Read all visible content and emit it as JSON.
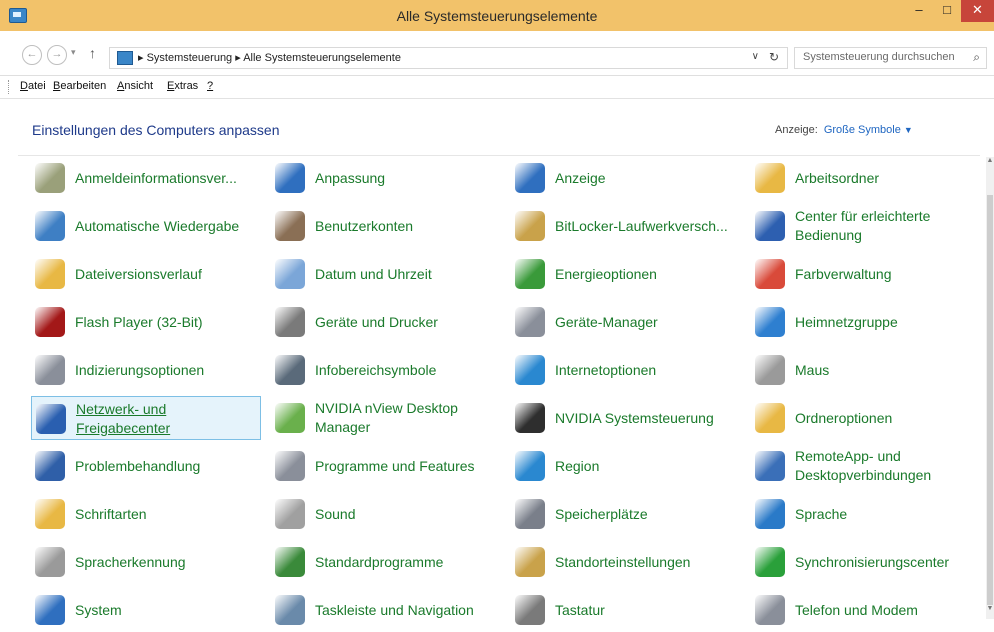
{
  "window": {
    "title": "Alle Systemsteuerungselemente",
    "controls": {
      "minimize": "–",
      "maximize": "□",
      "close": "✕"
    }
  },
  "address": {
    "back": "←",
    "forward": "→",
    "history": "▾",
    "up": "↑",
    "path": "▸ Systemsteuerung ▸ Alle Systemsteuerungselemente",
    "dropdown": "∨",
    "refresh": "↻",
    "search_placeholder": "Systemsteuerung durchsuchen",
    "search_icon": "⌕"
  },
  "menu": [
    {
      "accel": "D",
      "rest": "atei"
    },
    {
      "accel": "B",
      "rest": "earbeiten"
    },
    {
      "accel": "A",
      "rest": "nsicht"
    },
    {
      "accel": "E",
      "rest": "xtras",
      "prefix": ""
    },
    {
      "accel": "?",
      "rest": ""
    }
  ],
  "header": {
    "title": "Einstellungen des Computers anpassen",
    "view_label": "Anzeige:",
    "view_value": "Große Symbole",
    "view_caret": "▼"
  },
  "items": [
    {
      "label": "Anmeldeinformationsver...",
      "icon": "credential-manager-icon",
      "color": "#9aa07a"
    },
    {
      "label": "Anpassung",
      "icon": "personalization-icon",
      "color": "#2f6fbf"
    },
    {
      "label": "Anzeige",
      "icon": "display-icon",
      "color": "#2f6fbf"
    },
    {
      "label": "Arbeitsordner",
      "icon": "work-folders-icon",
      "color": "#e8b844"
    },
    {
      "label": "Automatische Wiedergabe",
      "icon": "autoplay-icon",
      "color": "#3e7fc4"
    },
    {
      "label": "Benutzerkonten",
      "icon": "user-accounts-icon",
      "color": "#8a6f55"
    },
    {
      "label": "BitLocker-Laufwerkversch...",
      "icon": "bitlocker-icon",
      "color": "#c9a24a"
    },
    {
      "label": "Center für erleichterte Bedienung",
      "icon": "ease-of-access-icon",
      "color": "#2d5fb0"
    },
    {
      "label": "Dateiversionsverlauf",
      "icon": "file-history-icon",
      "color": "#e8b844"
    },
    {
      "label": "Datum und Uhrzeit",
      "icon": "date-time-icon",
      "color": "#7ba6d8"
    },
    {
      "label": "Energieoptionen",
      "icon": "power-options-icon",
      "color": "#3a9a3a"
    },
    {
      "label": "Farbverwaltung",
      "icon": "color-management-icon",
      "color": "#d94a3a"
    },
    {
      "label": "Flash Player (32-Bit)",
      "icon": "flash-player-icon",
      "color": "#a31818"
    },
    {
      "label": "Geräte und Drucker",
      "icon": "devices-printers-icon",
      "color": "#7a7a7a"
    },
    {
      "label": "Geräte-Manager",
      "icon": "device-manager-icon",
      "color": "#8a8f9a"
    },
    {
      "label": "Heimnetzgruppe",
      "icon": "homegroup-icon",
      "color": "#2e7fd0"
    },
    {
      "label": "Indizierungsoptionen",
      "icon": "indexing-icon",
      "color": "#8a8f9a"
    },
    {
      "label": "Infobereichsymbole",
      "icon": "notification-icons-icon",
      "color": "#5a6a7a"
    },
    {
      "label": "Internetoptionen",
      "icon": "internet-options-icon",
      "color": "#2a88d0"
    },
    {
      "label": "Maus",
      "icon": "mouse-icon",
      "color": "#9a9a9a"
    },
    {
      "label": "Netzwerk- und Freigabecenter",
      "icon": "network-sharing-icon",
      "color": "#2a5fb0"
    },
    {
      "label": "NVIDIA nView Desktop Manager",
      "icon": "nvidia-nview-icon",
      "color": "#6ab04c"
    },
    {
      "label": "NVIDIA Systemsteuerung",
      "icon": "nvidia-control-panel-icon",
      "color": "#2e2e2e"
    },
    {
      "label": "Ordneroptionen",
      "icon": "folder-options-icon",
      "color": "#e8b844"
    },
    {
      "label": "Problembehandlung",
      "icon": "troubleshooting-icon",
      "color": "#2f5fa8"
    },
    {
      "label": "Programme und Features",
      "icon": "programs-features-icon",
      "color": "#8a8f9a"
    },
    {
      "label": "Region",
      "icon": "region-icon",
      "color": "#2a88d0"
    },
    {
      "label": "RemoteApp- und Desktopverbindungen",
      "icon": "remoteapp-icon",
      "color": "#3a6fb8"
    },
    {
      "label": "Schriftarten",
      "icon": "fonts-icon",
      "color": "#e8b844"
    },
    {
      "label": "Sound",
      "icon": "sound-icon",
      "color": "#a0a0a0"
    },
    {
      "label": "Speicherplätze",
      "icon": "storage-spaces-icon",
      "color": "#7a7f8a"
    },
    {
      "label": "Sprache",
      "icon": "language-icon",
      "color": "#2a7ac8"
    },
    {
      "label": "Spracherkennung",
      "icon": "speech-recognition-icon",
      "color": "#9a9a9a"
    },
    {
      "label": "Standardprogramme",
      "icon": "default-programs-icon",
      "color": "#3a8a3a"
    },
    {
      "label": "Standorteinstellungen",
      "icon": "location-settings-icon",
      "color": "#c9a24a"
    },
    {
      "label": "Synchronisierungscenter",
      "icon": "sync-center-icon",
      "color": "#2aa03a"
    },
    {
      "label": "System",
      "icon": "system-icon",
      "color": "#2f6fbf"
    },
    {
      "label": "Taskleiste und Navigation",
      "icon": "taskbar-navigation-icon",
      "color": "#6a8aaa"
    },
    {
      "label": "Tastatur",
      "icon": "keyboard-icon",
      "color": "#7a7a7a"
    },
    {
      "label": "Telefon und Modem",
      "icon": "phone-modem-icon",
      "color": "#8a8f9a"
    }
  ],
  "selected_index": 20
}
